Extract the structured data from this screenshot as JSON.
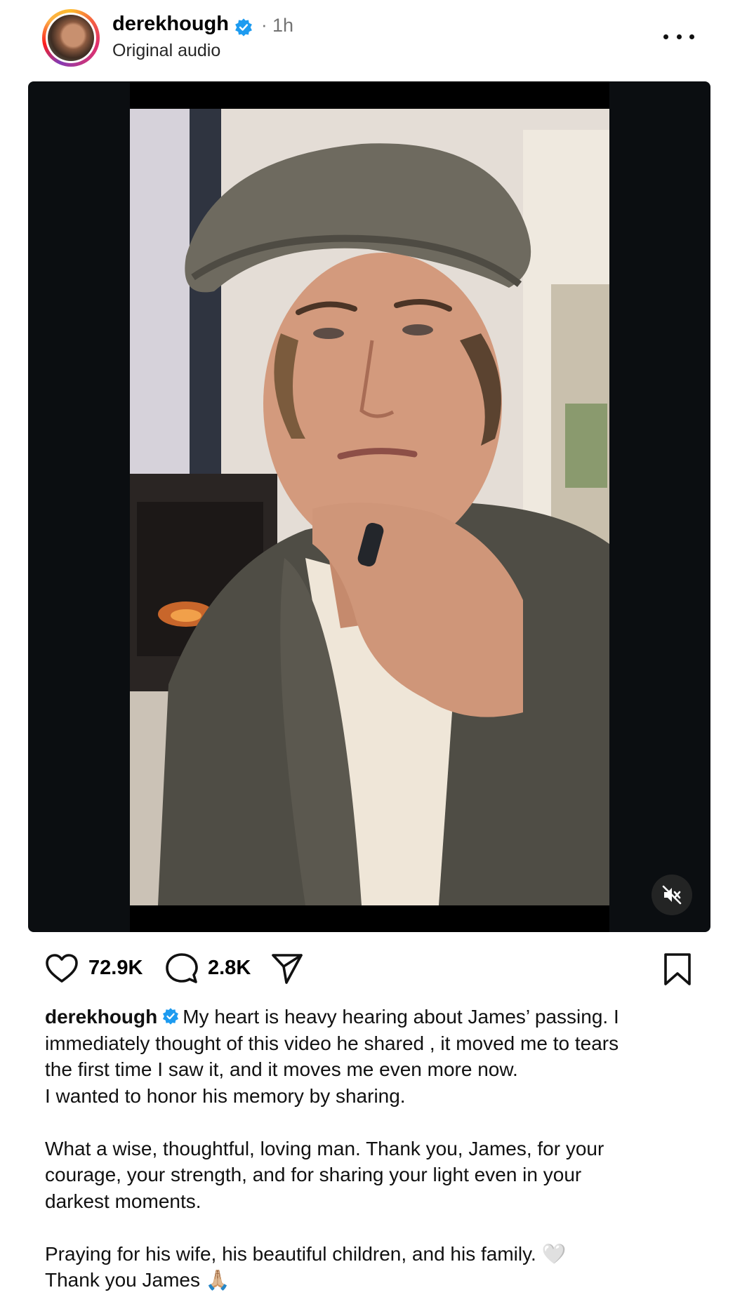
{
  "post": {
    "username": "derekhough",
    "time_sep": "·",
    "time": "1h",
    "audio": "Original audio"
  },
  "icons": {
    "more": "more-options-icon",
    "verified": "verified-badge-icon",
    "mute": "muted-speaker-icon",
    "like": "heart-icon",
    "comment": "comment-bubble-icon",
    "share": "paper-plane-icon",
    "save": "bookmark-icon"
  },
  "colors": {
    "verified": "#1d9bf0",
    "muted_text": "#737373",
    "media_background": "#0b0e11"
  },
  "stats": {
    "likes": "72.9K",
    "comments": "2.8K"
  },
  "caption": {
    "username": "derekhough",
    "line1": "My heart is heavy hearing about James’ passing. I",
    "line2": "immediately thought of this video he shared , it moved me to tears",
    "line3": "the first time I saw it, and it moves me even more now.",
    "line4": "I wanted to honor his memory by sharing.",
    "line5": "What a wise, thoughtful, loving man. Thank you, James, for your",
    "line6": "courage, your strength, and for sharing your light even in your",
    "line7": "darkest moments.",
    "line8": "Praying for his wife, his beautiful children, and his family. 🤍",
    "line9": "Thank you James 🙏🏼"
  }
}
